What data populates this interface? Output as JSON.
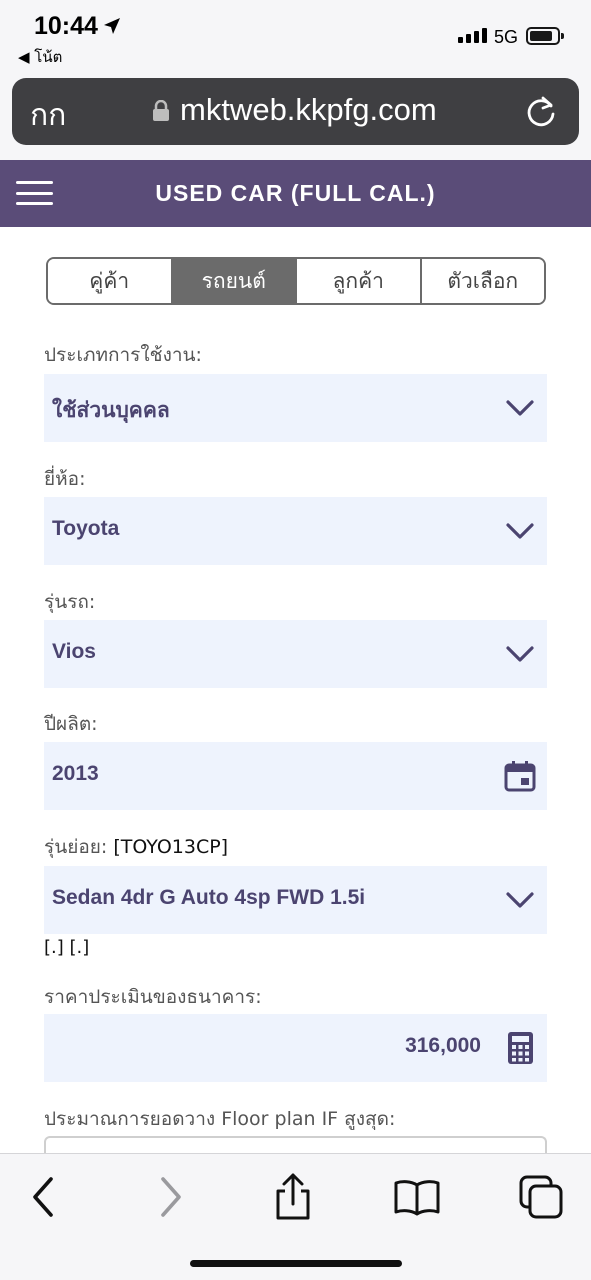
{
  "status_bar": {
    "time": "10:44",
    "network": "5G",
    "back_app": "◀ โน้ต",
    "icons": [
      "location-arrow-icon",
      "signal-icon",
      "battery-icon"
    ]
  },
  "browser": {
    "reader_label": "กก",
    "url": "mktweb.kkpfg.com",
    "icons": [
      "lock-icon",
      "reload-icon"
    ]
  },
  "header": {
    "title": "USED CAR (FULL CAL.)",
    "icon": "hamburger-menu-icon",
    "bg_color": "#5a4c78"
  },
  "tabs": [
    {
      "label": "คู่ค้า",
      "active": false
    },
    {
      "label": "รถยนต์",
      "active": true
    },
    {
      "label": "ลูกค้า",
      "active": false
    },
    {
      "label": "ตัวเลือก",
      "active": false
    }
  ],
  "form": {
    "usage_type": {
      "label": "ประเภทการใช้งาน:",
      "value": "ใช้ส่วนบุคคล"
    },
    "brand": {
      "label": "ยี่ห้อ:",
      "value": "Toyota"
    },
    "model": {
      "label": "รุ่นรถ:",
      "value": "Vios"
    },
    "year": {
      "label": "ปีผลิต:",
      "value": "2013"
    },
    "submodel": {
      "label": "รุ่นย่อย:",
      "code": "[TOYO13CP]",
      "value": "Sedan 4dr G Auto 4sp FWD 1.5i"
    },
    "submodel_note": "[.] [.]",
    "bank_price": {
      "label": "ราคาประเมินของธนาคาร:",
      "value": "316,000"
    },
    "floor_plan": {
      "label": "ประมาณการยอดวาง Floor plan IF สูงสุด:"
    }
  },
  "colors": {
    "field_bg": "#eef3fd",
    "value_text": "#4b4470",
    "tab_active": "#6b6b6b"
  },
  "toolbar": {
    "icons": [
      "back-icon",
      "forward-icon",
      "share-icon",
      "bookmarks-icon",
      "tabs-icon"
    ]
  }
}
